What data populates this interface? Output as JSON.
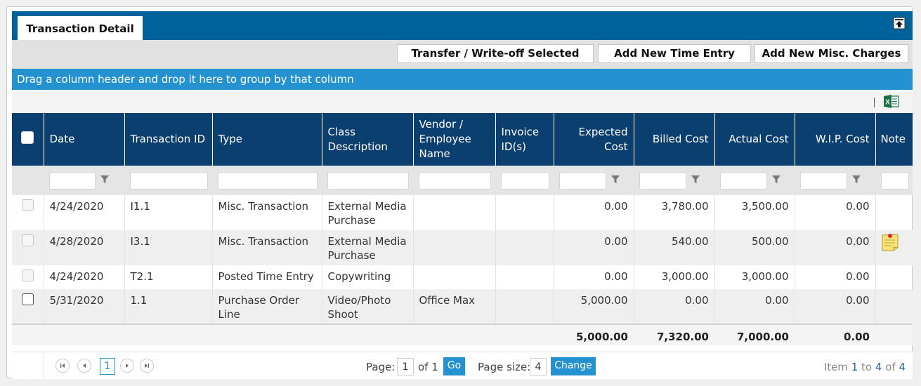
{
  "tabs": {
    "active": "Transaction Detail"
  },
  "toolbar": {
    "transfer_label": "Transfer / Write-off Selected",
    "add_time_label": "Add New Time Entry",
    "add_misc_label": "Add New Misc. Charges"
  },
  "group_bar": {
    "text": "Drag a column header and drop it here to group by that column"
  },
  "grid": {
    "columns": {
      "date": "Date",
      "transaction_id": "Transaction ID",
      "type": "Type",
      "class_description_1": "Class",
      "class_description_2": "Description",
      "vendor_1": "Vendor /",
      "vendor_2": "Employee",
      "vendor_3": "Name",
      "invoice_1": "Invoice",
      "invoice_2": "ID(s)",
      "expected_1": "Expected",
      "expected_2": "Cost",
      "billed": "Billed Cost",
      "actual": "Actual Cost",
      "wip": "W.I.P. Cost",
      "note": "Note"
    },
    "rows": [
      {
        "date": "4/24/2020",
        "transaction_id": "I1.1",
        "type": "Misc. Transaction",
        "class_1": "External Media",
        "class_2": "Purchase",
        "vendor": "",
        "invoice": "",
        "expected": "0.00",
        "billed": "3,780.00",
        "actual": "3,500.00",
        "wip": "0.00",
        "has_note": false
      },
      {
        "date": "4/28/2020",
        "transaction_id": "I3.1",
        "type": "Misc. Transaction",
        "class_1": "External Media",
        "class_2": "Purchase",
        "vendor": "",
        "invoice": "",
        "expected": "0.00",
        "billed": "540.00",
        "actual": "500.00",
        "wip": "0.00",
        "has_note": true
      },
      {
        "date": "4/24/2020",
        "transaction_id": "T2.1",
        "type": "Posted Time Entry",
        "class_1": "Copywriting",
        "class_2": "",
        "vendor": "",
        "invoice": "",
        "expected": "0.00",
        "billed": "3,000.00",
        "actual": "3,000.00",
        "wip": "0.00",
        "has_note": false
      },
      {
        "date": "5/31/2020",
        "transaction_id": "1.1",
        "type": "Purchase Order Line",
        "class_1": "Video/Photo",
        "class_2": "Shoot",
        "vendor": "Office Max",
        "invoice": "",
        "expected": "5,000.00",
        "billed": "0.00",
        "actual": "0.00",
        "wip": "0.00",
        "has_note": false
      }
    ],
    "totals": {
      "expected": "5,000.00",
      "billed": "7,320.00",
      "actual": "7,000.00",
      "wip": "0.00"
    }
  },
  "pager": {
    "current_page": "1",
    "page_label": "Page:",
    "page_value": "1",
    "of_label": "of 1",
    "go_label": "Go",
    "size_label": "Page size:",
    "size_value": "4",
    "change_label": "Change",
    "item_label": "Item",
    "item_from": "1",
    "to_label": "to",
    "item_to": "4",
    "of_total_label": "of",
    "item_total": "4"
  },
  "colors": {
    "tab_bar": "#00629b",
    "header": "#0b3f70",
    "group_bar": "#2492d0",
    "accent": "#2492d0"
  }
}
